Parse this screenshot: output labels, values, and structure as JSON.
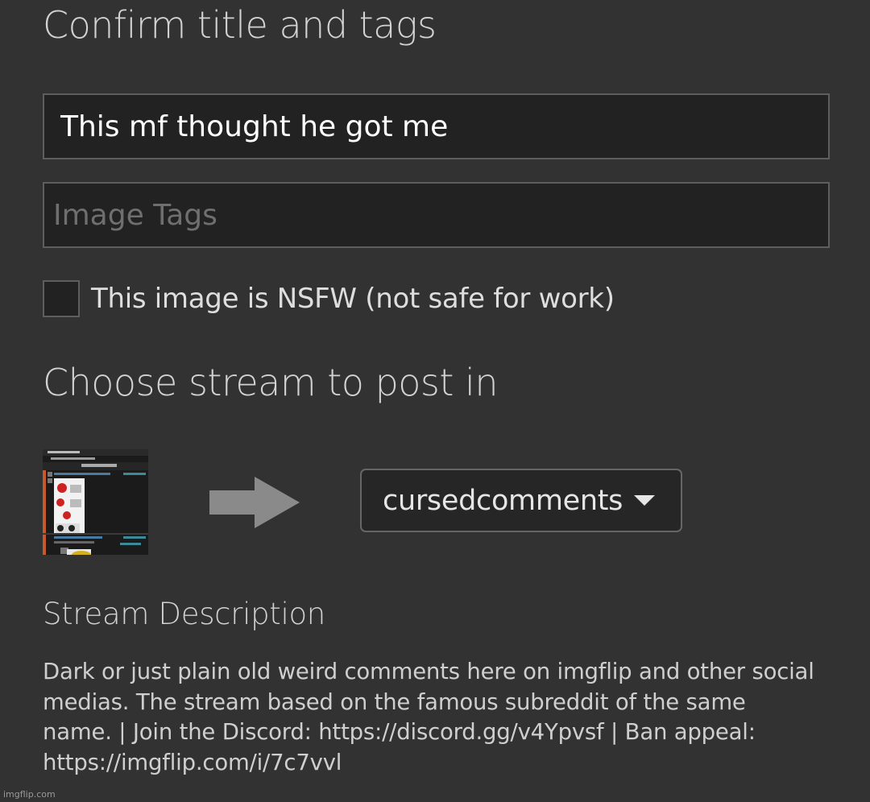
{
  "form": {
    "confirm_heading": "Confirm title and tags",
    "title_value": "This mf thought he got me",
    "tags_placeholder": "Image Tags",
    "tags_value": "",
    "nsfw_label": "This image is NSFW (not safe for work)",
    "nsfw_checked": false
  },
  "stream": {
    "heading": "Choose stream to post in",
    "selected": "cursedcomments",
    "arrow_icon": "right-arrow-icon",
    "caret_icon": "caret-down-icon"
  },
  "description": {
    "heading": "Stream Description",
    "text": "Dark or just plain old weird comments here on imgflip and other social medias. The stream based on the famous subreddit of the same name. | Join the Discord: https://discord.gg/v4Ypvsf | Ban appeal: https://imgflip.com/i/7c7vvl"
  },
  "watermark": "imgflip.com",
  "colors": {
    "background": "#323232",
    "input_bg": "#222222",
    "input_border": "#5e5e5e",
    "arrow": "#8a8a8a"
  }
}
